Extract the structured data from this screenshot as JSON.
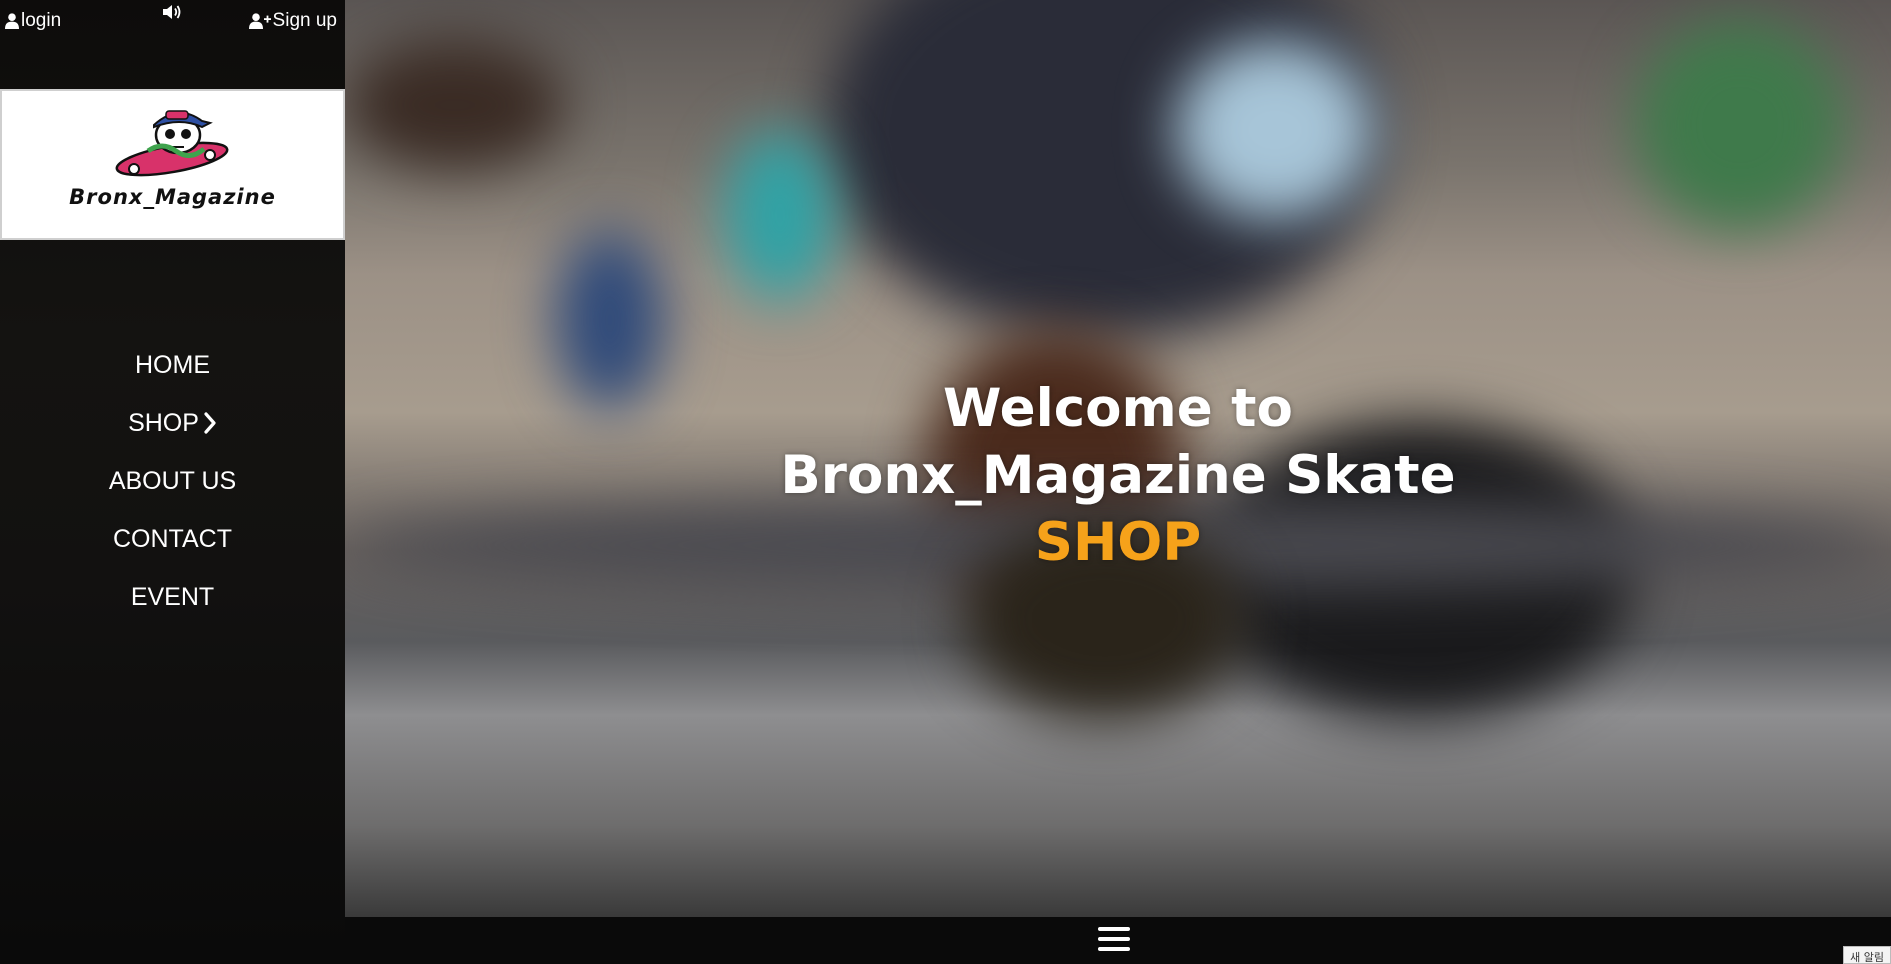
{
  "topbar": {
    "login_label": "login",
    "signup_label": "Sign up"
  },
  "logo": {
    "text": "Bronx_Magazine"
  },
  "nav": {
    "items": [
      {
        "label": "HOME"
      },
      {
        "label": "SHOP"
      },
      {
        "label": "ABOUT US"
      },
      {
        "label": "CONTACT"
      },
      {
        "label": "EVENT"
      }
    ]
  },
  "hero": {
    "line1": "Welcome to",
    "line2": "Bronx_Magazine Skate",
    "line3": "SHOP",
    "accent_color": "#f6a21a"
  },
  "notice": {
    "text": "새 알림"
  },
  "icons": {
    "login": "user-icon",
    "signup": "user-plus-icon",
    "sound": "volume-icon",
    "shop_arrow": "chevron-right-icon",
    "menu": "hamburger-menu-icon"
  }
}
